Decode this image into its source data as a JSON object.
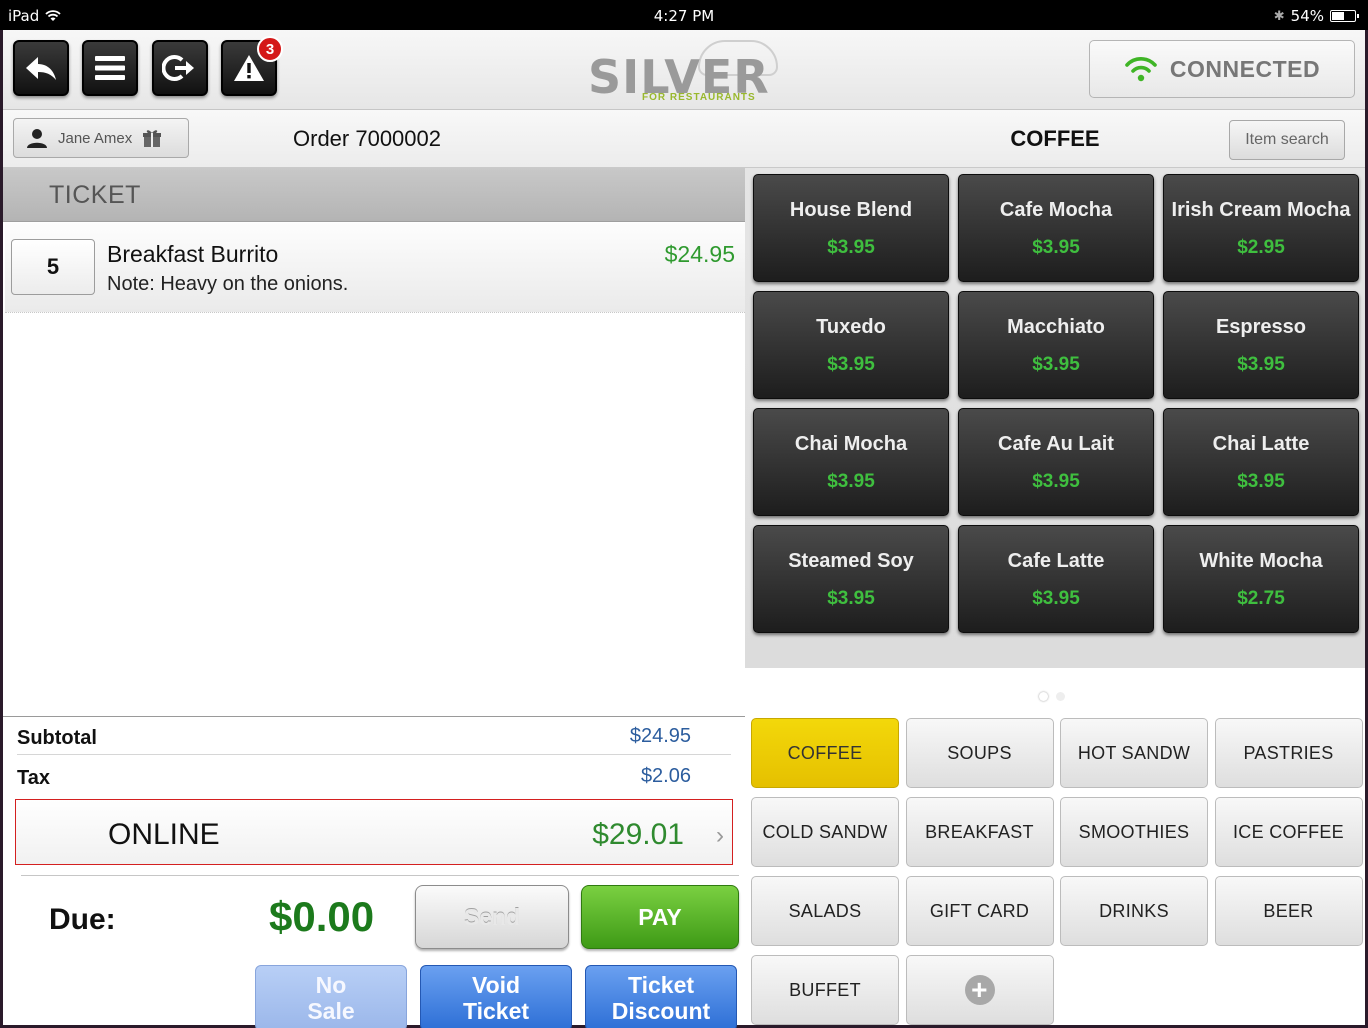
{
  "status_bar": {
    "device": "iPad",
    "time": "4:27 PM",
    "battery": "54%",
    "battery_level": 0.54
  },
  "header": {
    "back_icon": "back-arrow-icon",
    "menu_icon": "menu-icon",
    "exit_icon": "exit-icon",
    "alert_icon": "alert-triangle-icon",
    "alert_count": "3",
    "logo_word": "SILVER",
    "logo_sub": "FOR RESTAURANTS",
    "connection_label": "CONNECTED",
    "connection_color": "#3fb526"
  },
  "order": {
    "customer_name": "Jane Amex",
    "title": "Order 7000002",
    "ticket_label": "TICKET",
    "line_items": [
      {
        "qty": "5",
        "name": "Breakfast Burrito",
        "note": "Note: Heavy on the onions.",
        "price": "$24.95"
      }
    ],
    "subtotal_label": "Subtotal",
    "subtotal": "$24.95",
    "tax_label": "Tax",
    "tax": "$2.06",
    "payment_label": "ONLINE",
    "payment_amount": "$29.01",
    "due_label": "Due:",
    "due_amount": "$0.00"
  },
  "actions": {
    "send": "Send",
    "pay": "PAY",
    "no_sale_1": "No",
    "no_sale_2": "Sale",
    "void_1": "Void",
    "void_2": "Ticket",
    "discount_1": "Ticket",
    "discount_2": "Discount"
  },
  "menu": {
    "category_title": "COFFEE",
    "item_search": "Item search",
    "items": [
      {
        "name": "House Blend",
        "price": "$3.95"
      },
      {
        "name": "Cafe Mocha",
        "price": "$3.95"
      },
      {
        "name": "Irish Cream Mocha",
        "price": "$2.95"
      },
      {
        "name": "Tuxedo",
        "price": "$3.95"
      },
      {
        "name": "Macchiato",
        "price": "$3.95"
      },
      {
        "name": "Espresso",
        "price": "$3.95"
      },
      {
        "name": "Chai Mocha",
        "price": "$3.95"
      },
      {
        "name": "Cafe Au Lait",
        "price": "$3.95"
      },
      {
        "name": "Chai Latte",
        "price": "$3.95"
      },
      {
        "name": "Steamed Soy",
        "price": "$3.95"
      },
      {
        "name": "Cafe Latte",
        "price": "$3.95"
      },
      {
        "name": "White Mocha",
        "price": "$2.75"
      }
    ],
    "categories": [
      {
        "label": "COFFEE",
        "active": true
      },
      {
        "label": "SOUPS"
      },
      {
        "label": "HOT SANDW"
      },
      {
        "label": "PASTRIES"
      },
      {
        "label": "COLD SANDW"
      },
      {
        "label": "BREAKFAST"
      },
      {
        "label": "SMOOTHIES"
      },
      {
        "label": "ICE COFFEE"
      },
      {
        "label": "SALADS"
      },
      {
        "label": "GIFT CARD"
      },
      {
        "label": "DRINKS"
      },
      {
        "label": "BEER"
      },
      {
        "label": "BUFFET"
      }
    ],
    "add_category_icon": "plus-circle-icon"
  }
}
